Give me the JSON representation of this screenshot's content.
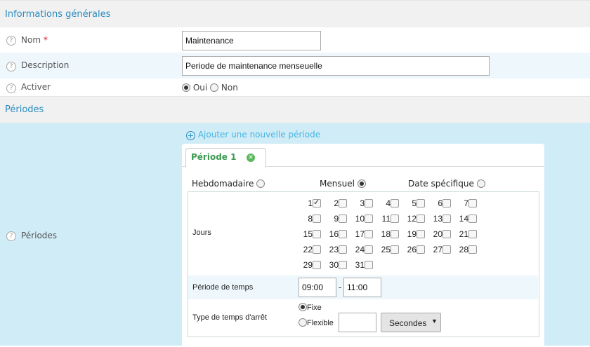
{
  "general": {
    "title": "Informations générales",
    "name_label": "Nom",
    "required_mark": "*",
    "name_value": "Maintenance",
    "description_label": "Description",
    "description_value": "Periode de maintenance menseuelle",
    "activate_label": "Activer",
    "activate_options": {
      "yes": "Oui",
      "no": "Non"
    },
    "activate_selected": "Oui"
  },
  "periods": {
    "title": "Périodes",
    "row_label": "Périodes",
    "add_link": "Ajouter une nouvelle période",
    "tab_label": "Période 1",
    "types": {
      "weekly": "Hebdomadaire",
      "monthly": "Mensuel",
      "specific": "Date spécifique"
    },
    "type_selected": "Mensuel",
    "days_label": "Jours",
    "days_checked": [
      1
    ],
    "time_label": "Période de temps",
    "time_start": "09:00",
    "time_separator": "-",
    "time_end": "11:00",
    "downtime_label": "Type de temps d'arrêt",
    "downtime_options": {
      "fixed": "Fixe",
      "flexible": "Flexible"
    },
    "downtime_selected": "Fixe",
    "duration_value": "",
    "duration_unit": "Secondes"
  },
  "colors": {
    "accent": "#2a8bbf",
    "period_bg": "#cfecf7",
    "row_alt": "#eef8fc",
    "tab_green": "#3c9a52"
  }
}
